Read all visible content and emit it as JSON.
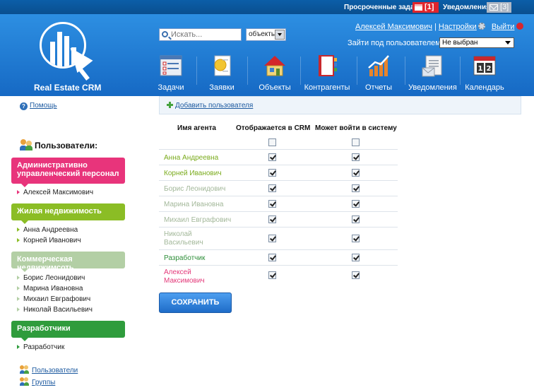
{
  "topbar": {
    "overdue_label": "Просроченные задачи",
    "overdue_count": "[1]",
    "notifications_label": "Уведомления",
    "notifications_count": "[3]"
  },
  "brand": {
    "name": "Real Estate CRM"
  },
  "search": {
    "placeholder": "Искать...",
    "scope": "объекты"
  },
  "user": {
    "name": "Алексей Максимович",
    "separator": "|",
    "settings": "Настройки",
    "logout": "Выйти",
    "login_as_label": "Зайти под пользователем:",
    "login_as_value": "Не выбран"
  },
  "nav": [
    {
      "label": "Задачи"
    },
    {
      "label": "Заявки"
    },
    {
      "label": "Объекты"
    },
    {
      "label": "Контрагенты"
    },
    {
      "label": "Отчеты"
    },
    {
      "label": "Уведомления"
    },
    {
      "label": "Календарь"
    }
  ],
  "sidebar": {
    "help": "Помощь",
    "users_title": "Пользователи:",
    "groups": [
      {
        "title": "Административно управленческий персонал",
        "color": "#e8347b",
        "members": [
          "Алексей Максимович"
        ]
      },
      {
        "title": "Жилая недвижимость",
        "color": "#8bbd25",
        "members": [
          "Анна Андреевна",
          "Корней Иванович"
        ]
      },
      {
        "title": "Коммерческая недвижимсоть",
        "color": "#b3cfa5",
        "members": [
          "Борис Леонидович",
          "Марина Ивановна",
          "Михаил Евграфович",
          "Николай Васильевич"
        ]
      },
      {
        "title": "Разработчики",
        "color": "#2f9c3c",
        "members": [
          "Разработчик"
        ]
      }
    ],
    "bottom_links": [
      "Пользователи",
      "Группы"
    ]
  },
  "main": {
    "add_user": "Добавить пользователя",
    "table": {
      "columns": [
        "Имя агента",
        "Отображается в CRM",
        "Может войти в систему"
      ],
      "header_checks": {
        "shown": false,
        "login": false
      },
      "rows": [
        {
          "name": "Анна Андреевна",
          "color": "#7aab1c",
          "shown": true,
          "login": true
        },
        {
          "name": "Корней Иванович",
          "color": "#7aab1c",
          "shown": true,
          "login": true
        },
        {
          "name": "Борис Леонидович",
          "color": "#a3b89a",
          "shown": true,
          "login": true
        },
        {
          "name": "Марина Ивановна",
          "color": "#a3b89a",
          "shown": true,
          "login": true
        },
        {
          "name": "Михаил Евграфович",
          "color": "#a3b89a",
          "shown": true,
          "login": true
        },
        {
          "name": "Николай Васильевич",
          "color": "#a3b89a",
          "shown": true,
          "login": true
        },
        {
          "name": "Разработчик",
          "color": "#2f8f3a",
          "shown": true,
          "login": true
        },
        {
          "name": "Алексей Максимович",
          "color": "#e33a7a",
          "shown": true,
          "login": true
        }
      ]
    },
    "save": "СОХРАНИТЬ"
  }
}
